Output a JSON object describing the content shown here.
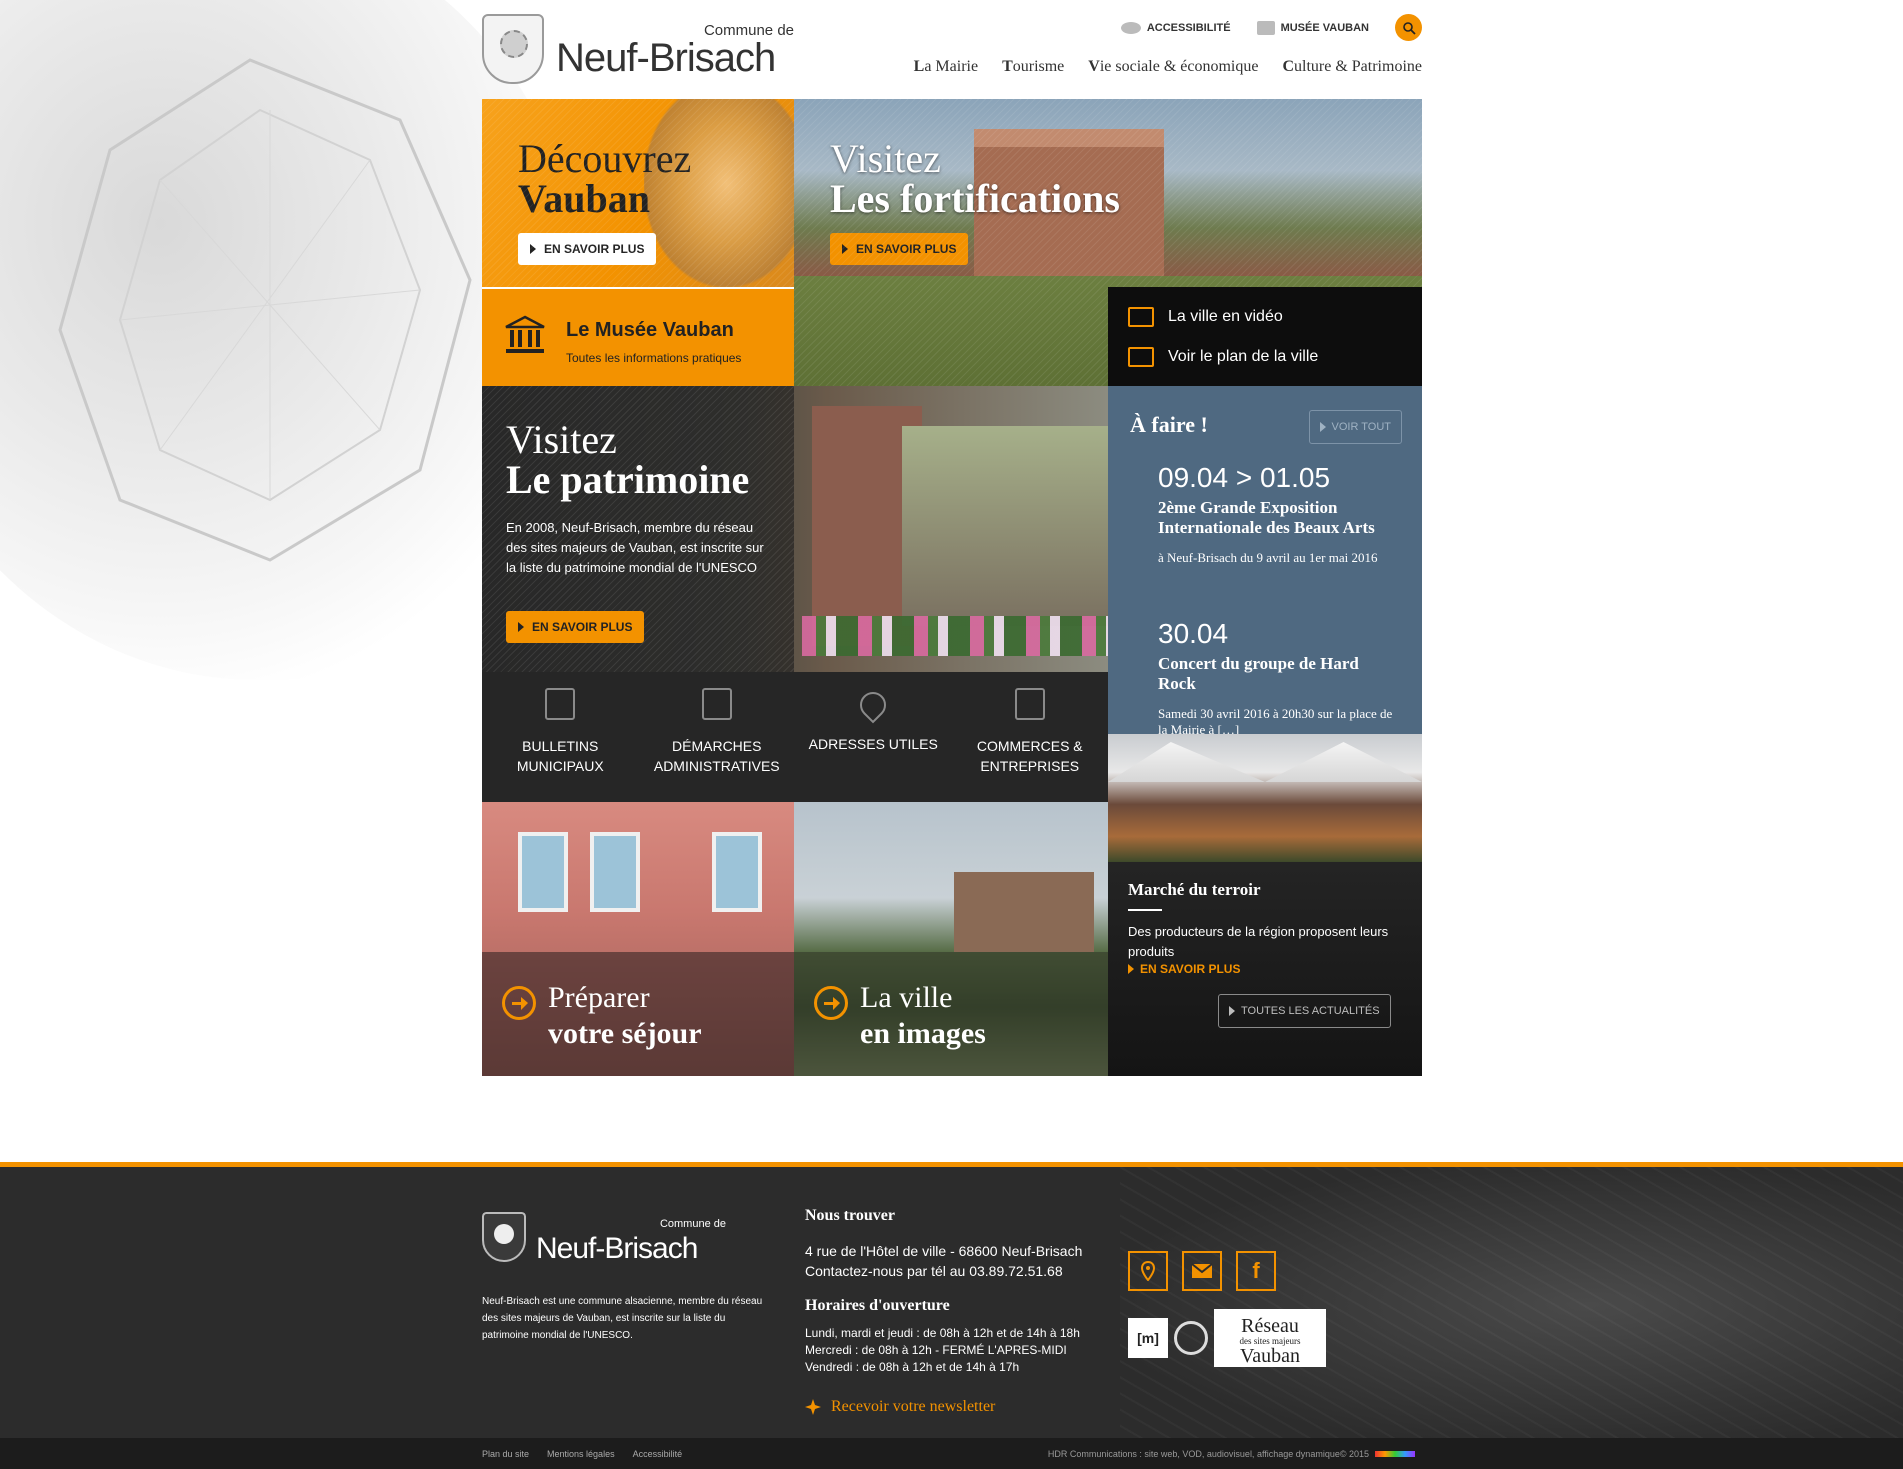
{
  "header": {
    "logo_small": "Commune de",
    "logo_big": "Neuf-Brisach",
    "top_links": [
      "ACCESSIBILITÉ",
      "MUSÉE VAUBAN"
    ],
    "nav": [
      {
        "first": "L",
        "rest": "a Mairie"
      },
      {
        "first": "T",
        "rest": "ourisme"
      },
      {
        "first": "V",
        "rest": "ie sociale & économique"
      },
      {
        "first": "C",
        "rest": "ulture & Patrimoine"
      }
    ]
  },
  "hero": {
    "vauban": {
      "line1": "Découvrez",
      "line2": "Vauban",
      "button": "EN SAVOIR PLUS"
    },
    "fortifications": {
      "line1": "Visitez",
      "line2": "Les fortifications",
      "button": "EN SAVOIR PLUS"
    },
    "musee": {
      "title": "Le Musée Vauban",
      "subtitle": "Toutes les informations pratiques"
    },
    "video_links": [
      "La ville en vidéo",
      "Voir le plan de la ville"
    ]
  },
  "patrimoine": {
    "line1": "Visitez",
    "line2": "Le patrimoine",
    "text": "En 2008, Neuf-Brisach, membre du réseau des sites majeurs de Vauban, est inscrite sur la liste du patrimoine mondial de l'UNESCO",
    "button": "EN SAVOIR PLUS"
  },
  "afaire": {
    "title": "À faire !",
    "button": "VOIR TOUT",
    "events": [
      {
        "date": "09.04 > 01.05",
        "title": "2ème Grande Exposition Internationale des Beaux Arts",
        "desc": "à Neuf-Brisach du 9 avril au 1er mai 2016"
      },
      {
        "date": "30.04",
        "title": "Concert du groupe de Hard Rock",
        "desc": "Samedi 30 avril 2016 à 20h30 sur la place de la Mairie à […]"
      }
    ]
  },
  "quick_links": [
    {
      "label": "BULLETINS MUNICIPAUX",
      "icon": "newspaper-icon"
    },
    {
      "label": "DÉMARCHES ADMINISTRATIVES",
      "icon": "form-edit-icon"
    },
    {
      "label": "ADRESSES UTILES",
      "icon": "map-pin-icon"
    },
    {
      "label": "COMMERCES & ENTREPRISES",
      "icon": "shop-icon"
    }
  ],
  "actualite": {
    "title": "Marché du terroir",
    "text": "Des producteurs de la région proposent leurs produits",
    "more": "EN SAVOIR PLUS",
    "all": "TOUTES LES ACTUALITÉS"
  },
  "bottom_tiles": [
    {
      "line1": "Préparer",
      "line2": "votre séjour"
    },
    {
      "line1": "La ville",
      "line2": "en images"
    }
  ],
  "footer": {
    "logo_small": "Commune de",
    "logo_big": "Neuf-Brisach",
    "description": "Neuf-Brisach est une commune alsacienne, membre du réseau des sites majeurs de Vauban, est inscrite sur la liste du patrimoine mondial de l'UNESCO.",
    "find_title": "Nous trouver",
    "address": "4 rue de l'Hôtel de ville - 68600 Neuf-Brisach",
    "phone": "Contactez-nous par tél au 03.89.72.51.68",
    "hours_title": "Horaires d'ouverture",
    "hours": [
      "Lundi, mardi et jeudi : de 08h à 12h et de 14h à 18h",
      "Mercredi : de 08h à 12h - FERMÉ L'APRES-MIDI",
      "Vendredi : de 08h à 12h et de 14h à 17h"
    ],
    "newsletter": "Recevoir votre newsletter",
    "partner_reseau_line1": "Réseau",
    "partner_reseau_line2": "des sites majeurs",
    "partner_reseau_line3": "Vauban"
  },
  "bottom_bar": {
    "links": [
      "Plan du site",
      "Mentions légales",
      "Accessibilité"
    ],
    "credit": "HDR Communications : site web, VOD, audiovisuel, affichage dynamique© 2015"
  },
  "colors": {
    "accent": "#f39200",
    "event_bg": "#4f6981",
    "footer_bg": "#2c2c2c"
  }
}
